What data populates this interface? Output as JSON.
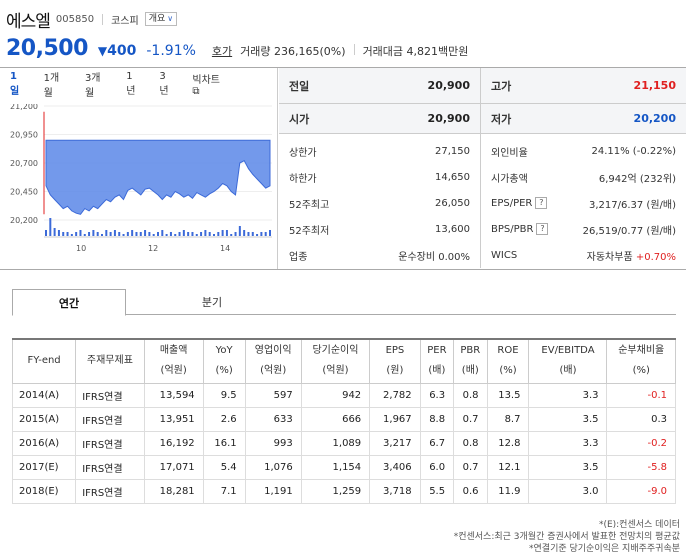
{
  "header": {
    "name": "에스엘",
    "code": "005850",
    "market": "코스피",
    "overview_label": "개요",
    "price": "20,500",
    "change_arrow": "▼",
    "change": "400",
    "change_pct": "-1.91%",
    "hoga": "호가",
    "volume_label": "거래량",
    "volume": "236,165(0%)",
    "amount_label": "거래대금",
    "amount": "4,821백만원"
  },
  "chart_tabs": [
    "1일",
    "1개월",
    "3개월",
    "1년",
    "3년",
    "빅차트"
  ],
  "chart_data": {
    "type": "area",
    "yticks": [
      "21,200",
      "20,950",
      "20,700",
      "20,450",
      "20,200"
    ],
    "xticks": [
      "10",
      "12",
      "14"
    ],
    "ylim": [
      20200,
      21200
    ],
    "prev_close": 20900,
    "price_series": [
      20500,
      20420,
      20380,
      20340,
      20300,
      20320,
      20280,
      20260,
      20250,
      20300,
      20280,
      20320,
      20300,
      20340,
      20380,
      20360,
      20400,
      20420,
      20380,
      20460,
      20480,
      20450,
      20420,
      20470,
      20480,
      20450,
      20420,
      20380,
      20420,
      20400,
      20450,
      20430,
      20400,
      20420,
      20390,
      20440,
      20420,
      20400,
      20430,
      20450,
      20480,
      20520,
      20500,
      20450,
      20420,
      20700,
      20720,
      20650,
      20600,
      20560,
      20520,
      20480,
      20500
    ]
  },
  "quote": {
    "prev_label": "전일",
    "prev": "20,900",
    "high_label": "고가",
    "high": "21,150",
    "open_label": "시가",
    "open": "20,900",
    "low_label": "저가",
    "low": "20,200"
  },
  "details_left": [
    {
      "k": "상한가",
      "v": "27,150"
    },
    {
      "k": "하한가",
      "v": "14,650"
    },
    {
      "k": "52주최고",
      "v": "26,050"
    },
    {
      "k": "52주최저",
      "v": "13,600"
    },
    {
      "k": "업종",
      "v": "운수장비 0.00%"
    }
  ],
  "details_right": [
    {
      "k": "외인비율",
      "v": "24.11% (-0.22%)"
    },
    {
      "k": "시가총액",
      "v": "6,942억 (232위)"
    },
    {
      "k": "EPS/PER",
      "v": "3,217/6.37 (원/배)"
    },
    {
      "k": "BPS/PBR",
      "v": "26,519/0.77 (원/배)"
    },
    {
      "k": "WICS",
      "v": "자동차부품",
      "v2": "+0.70%"
    }
  ],
  "tabs": {
    "annual": "연간",
    "quarter": "분기"
  },
  "table": {
    "headers": [
      [
        "FY-end"
      ],
      [
        "주재무제표"
      ],
      [
        "매출액",
        "(억원)"
      ],
      [
        "YoY",
        "(%)"
      ],
      [
        "영업이익",
        "(억원)"
      ],
      [
        "당기순이익",
        "(억원)"
      ],
      [
        "EPS",
        "(원)"
      ],
      [
        "PER",
        "(배)"
      ],
      [
        "PBR",
        "(배)"
      ],
      [
        "ROE",
        "(%)"
      ],
      [
        "EV/EBITDA",
        "(배)"
      ],
      [
        "순부채비율",
        "(%)"
      ]
    ],
    "rows": [
      [
        "2014(A)",
        "IFRS연결",
        "13,594",
        "9.5",
        "597",
        "942",
        "2,782",
        "6.3",
        "0.8",
        "13.5",
        "3.3",
        "-0.1"
      ],
      [
        "2015(A)",
        "IFRS연결",
        "13,951",
        "2.6",
        "633",
        "666",
        "1,967",
        "8.8",
        "0.7",
        "8.7",
        "3.5",
        "0.3"
      ],
      [
        "2016(A)",
        "IFRS연결",
        "16,192",
        "16.1",
        "993",
        "1,089",
        "3,217",
        "6.7",
        "0.8",
        "12.8",
        "3.3",
        "-0.2"
      ],
      [
        "2017(E)",
        "IFRS연결",
        "17,071",
        "5.4",
        "1,076",
        "1,154",
        "3,406",
        "6.0",
        "0.7",
        "12.1",
        "3.5",
        "-5.8"
      ],
      [
        "2018(E)",
        "IFRS연결",
        "18,281",
        "7.1",
        "1,191",
        "1,259",
        "3,718",
        "5.5",
        "0.6",
        "11.9",
        "3.0",
        "-9.0"
      ]
    ]
  },
  "notes": [
    "*(E):컨센서스 데이터",
    "*컨센서스:최근 3개월간 증권사에서 발표한 전망치의 평균값",
    "*연결기준 당기순이익은 지배주주귀속분"
  ]
}
